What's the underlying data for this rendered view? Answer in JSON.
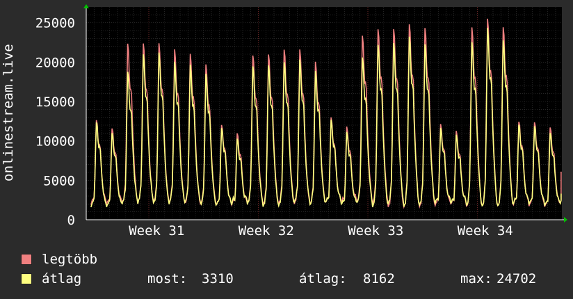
{
  "chart_data": {
    "type": "line",
    "ylabel": "onlinestream.live",
    "xlabel": "",
    "ylim": [
      0,
      27000
    ],
    "y_ticks": [
      0,
      5000,
      10000,
      15000,
      20000,
      25000
    ],
    "x_ticks": [
      "Week 31",
      "Week 32",
      "Week 33",
      "Week 34"
    ],
    "x_tick_days": [
      4,
      11,
      18,
      25
    ],
    "x_range_days": [
      0,
      30.4
    ],
    "grid": true,
    "colors": {
      "background": "#000000",
      "grid": "#3a3a3a",
      "max": "#f08080",
      "avg": "#ffff80",
      "axis": "#ffffff",
      "arrow": "#00c000"
    },
    "series": [
      {
        "name": "legtöbb",
        "daily_peaks": [
          12900,
          11800,
          22700,
          22700,
          22700,
          21900,
          21300,
          19900,
          12300,
          11200,
          21200,
          21300,
          21900,
          21900,
          20300,
          13100,
          11900,
          23800,
          24600,
          24600,
          25200,
          24700,
          12300,
          11400,
          24700,
          25800,
          24900,
          12700,
          12600,
          11900,
          11100
        ]
      },
      {
        "name": "átlag",
        "daily_peaks": [
          12600,
          11200,
          19100,
          21300,
          21500,
          20300,
          19900,
          18700,
          11900,
          10500,
          19800,
          19900,
          20300,
          20600,
          19100,
          12800,
          11200,
          21000,
          22600,
          22800,
          23600,
          22600,
          11800,
          10900,
          22800,
          24600,
          23200,
          12300,
          12100,
          11200,
          10600
        ]
      }
    ],
    "current_value_at_end": 3310
  },
  "legend": {
    "max_label": "legtöbb",
    "avg_label": "átlag",
    "max_color": "#f08080",
    "avg_color": "#ffff80"
  },
  "stats": {
    "now_label": "most:",
    "now_value": "3310",
    "avg_label": "átlag:",
    "avg_value": "8162",
    "max_label": "max:",
    "max_value": "24702"
  }
}
